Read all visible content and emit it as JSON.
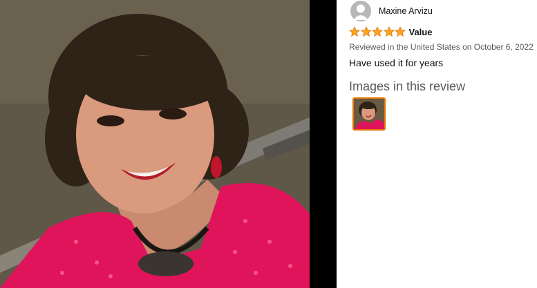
{
  "reviewer": {
    "name": "Maxine Arvizu",
    "avatar_icon": "user-avatar-icon"
  },
  "review": {
    "rating": 5,
    "rating_max": 5,
    "title": "Value",
    "meta": "Reviewed in the United States on October 6, 2022",
    "body": "Have used it for years"
  },
  "images_section": {
    "heading": "Images in this review"
  },
  "colors": {
    "star": "#ffa41c",
    "star_outline": "#de7921",
    "thumb_border": "#e77600",
    "text_secondary": "#565959"
  }
}
